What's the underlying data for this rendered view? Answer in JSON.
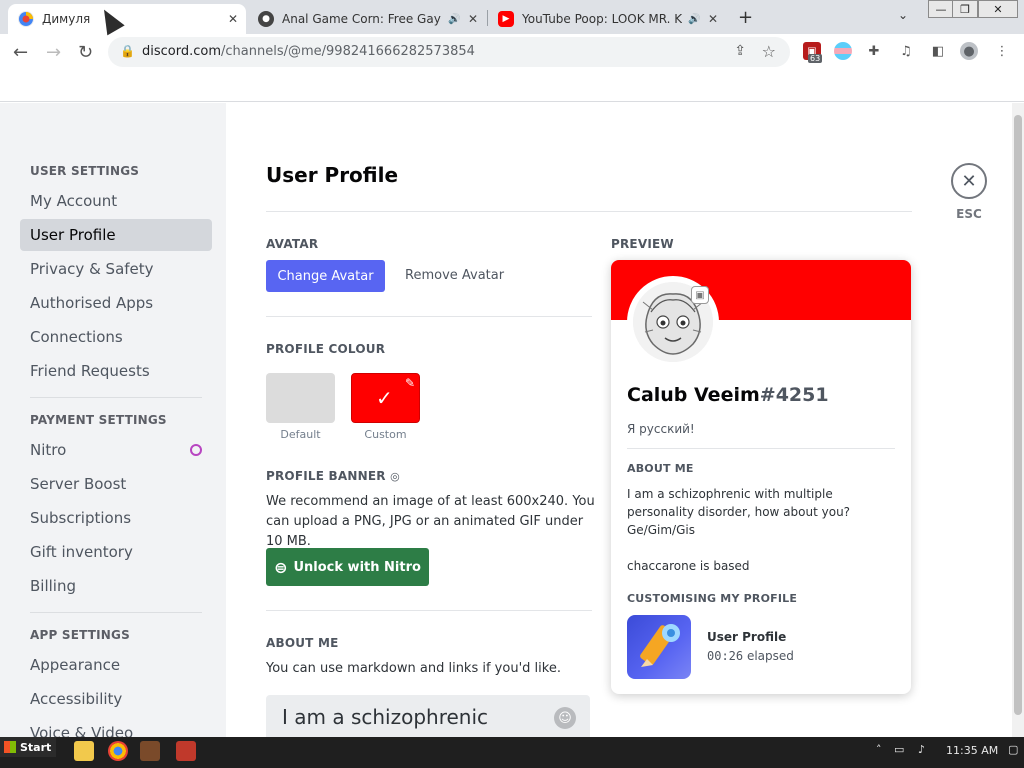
{
  "browser": {
    "tabs": [
      {
        "title": "Димуля",
        "active": true,
        "favicon": "discord-like-icon"
      },
      {
        "title": "Anal Game Corn: Free Gay H",
        "active": false,
        "favicon": "pawprint-icon",
        "audio": true
      },
      {
        "title": "YouTube Poop: LOOK MR. KR",
        "active": false,
        "favicon": "youtube-icon",
        "audio": true
      }
    ],
    "new_tab": "+",
    "window_controls": [
      "—",
      "❐",
      "✕"
    ],
    "url_host": "discord.com",
    "url_path": "/channels/@me/998241666282573854",
    "extension_badge": "63"
  },
  "sidebar": {
    "user_settings_header": "USER SETTINGS",
    "user_settings": [
      "My Account",
      "User Profile",
      "Privacy & Safety",
      "Authorised Apps",
      "Connections",
      "Friend Requests"
    ],
    "payment_settings_header": "PAYMENT SETTINGS",
    "payment_settings": [
      "Nitro",
      "Server Boost",
      "Subscriptions",
      "Gift inventory",
      "Billing"
    ],
    "app_settings_header": "APP SETTINGS",
    "app_settings": [
      "Appearance",
      "Accessibility",
      "Voice & Video"
    ],
    "selected": "User Profile"
  },
  "content": {
    "title": "User Profile",
    "avatar_section": "AVATAR",
    "change_avatar": "Change Avatar",
    "remove_avatar": "Remove Avatar",
    "profile_colour_section": "PROFILE COLOUR",
    "colour_default_label": "Default",
    "colour_custom_label": "Custom",
    "colour_default_hex": "#dcdcdc",
    "colour_custom_hex": "#ff0000",
    "profile_banner_section": "PROFILE BANNER",
    "profile_banner_desc": "We recommend an image of at least 600x240. You can upload a PNG, JPG or an animated GIF under 10 MB.",
    "unlock_nitro": "Unlock with Nitro",
    "about_me_section": "ABOUT ME",
    "about_me_hint": "You can use markdown and links if you'd like.",
    "about_me_value": "I am a schizophrenic",
    "esc_label": "ESC",
    "preview_section": "PREVIEW"
  },
  "preview": {
    "username": "Calub Veeim",
    "discriminator": "#4251",
    "custom_status": "Я русский!",
    "about_me_header": "ABOUT ME",
    "bio_line1": "I am a schizophrenic with multiple personality disorder, how about you? Ge/Gim/Gis",
    "bio_line2": "chaccarone is based",
    "customising_header": "CUSTOMISING MY PROFILE",
    "activity_title": "User Profile",
    "activity_time": "00:26",
    "activity_suffix": " elapsed",
    "banner_color": "#ff0000"
  },
  "taskbar": {
    "start": "Start",
    "clock": "11:35 AM"
  }
}
